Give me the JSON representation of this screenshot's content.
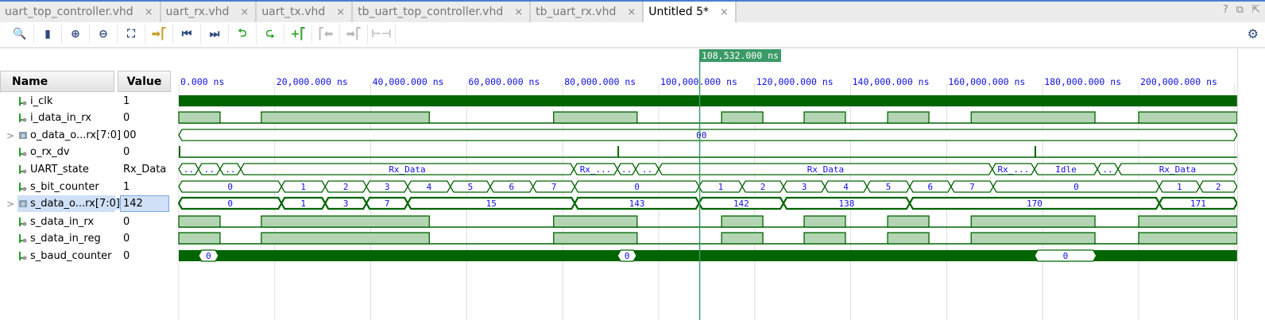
{
  "tabs": [
    {
      "label": "uart_top_controller.vhd",
      "active": false
    },
    {
      "label": "uart_rx.vhd",
      "active": false
    },
    {
      "label": "uart_tx.vhd",
      "active": false
    },
    {
      "label": "tb_uart_top_controller.vhd",
      "active": false
    },
    {
      "label": "tb_uart_rx.vhd",
      "active": false
    },
    {
      "label": "Untitled 5*",
      "active": true
    }
  ],
  "tab_close": "×",
  "window_controls": {
    "help": "?",
    "restore": "⧉",
    "float": "⇱"
  },
  "toolbar": [
    {
      "icon": "search-icon",
      "glyph": "🔍",
      "color": "#2d4a80"
    },
    {
      "icon": "save-icon",
      "glyph": "▮",
      "color": "#2d4a80"
    },
    {
      "icon": "zoom-in-icon",
      "glyph": "⊕",
      "color": "#2d4a80"
    },
    {
      "icon": "zoom-out-icon",
      "glyph": "⊖",
      "color": "#2d4a80"
    },
    {
      "icon": "zoom-fit-icon",
      "glyph": "⛶",
      "color": "#2d4a80"
    },
    {
      "icon": "go-to-cursor-icon",
      "glyph": "➡⎡",
      "color": "#c8a030"
    },
    {
      "icon": "go-to-start-icon",
      "glyph": "⏮",
      "color": "#2d4a80"
    },
    {
      "icon": "go-to-end-icon",
      "glyph": "⏭",
      "color": "#2d4a80"
    },
    {
      "icon": "previous-transition-icon",
      "glyph": "⮌",
      "color": "#2aa02a"
    },
    {
      "icon": "next-transition-icon",
      "glyph": "⮎",
      "color": "#2aa02a"
    },
    {
      "icon": "add-marker-icon",
      "glyph": "+⎡",
      "color": "#2aa02a"
    },
    {
      "icon": "previous-marker-icon",
      "glyph": "⎡⬅",
      "color": "#bbb"
    },
    {
      "icon": "next-marker-icon",
      "glyph": "➡⎡",
      "color": "#bbb"
    },
    {
      "icon": "swap-cursors-icon",
      "glyph": "⊢⊣",
      "color": "#bbb"
    }
  ],
  "headers": {
    "name": "Name",
    "value": "Value"
  },
  "cursor": {
    "label": "108,532.000 ns",
    "time": 108.532
  },
  "time_unit": "M ns",
  "ticks": [
    "0.000 ns",
    "20,000.000 ns",
    "40,000.000 ns",
    "60,000.000 ns",
    "80,000.000 ns",
    "100,000.000 ns",
    "120,000.000 ns",
    "140,000.000 ns",
    "160,000.000 ns",
    "180,000.000 ns",
    "200,000.000 ns"
  ],
  "end_time": 220.5,
  "colors": {
    "wave": "#006400",
    "high_fill": "#b3d5b3",
    "text": "#1010e0",
    "cursor": "#3b9a67"
  },
  "signals": [
    {
      "name": "i_clk",
      "value": "1",
      "kind": "clock"
    },
    {
      "name": "i_data_in_rx",
      "value": "0",
      "kind": "bit",
      "high": [
        [
          0,
          8.6
        ],
        [
          17.2,
          52.2
        ],
        [
          78.1,
          95.5
        ],
        [
          113.1,
          121.7
        ],
        [
          130.3,
          138.9
        ],
        [
          147.7,
          156.3
        ],
        [
          165.1,
          190.9
        ],
        [
          200,
          220.5
        ]
      ]
    },
    {
      "name": "o_data_o...rx[7:0]",
      "value": "00",
      "kind": "bus",
      "expandable": true,
      "segments": [
        [
          0,
          220.5,
          "00"
        ]
      ],
      "label_at": 108.9
    },
    {
      "name": "o_rx_dv",
      "value": "0",
      "kind": "pulse",
      "pulses": [
        0,
        91.4,
        178.3
      ]
    },
    {
      "name": "UART_state",
      "value": "Rx_Data",
      "kind": "bus",
      "segments": [
        [
          0,
          4.1,
          ".."
        ],
        [
          4.1,
          8.6,
          ".."
        ],
        [
          8.6,
          12.9,
          ".."
        ],
        [
          12.9,
          82.3,
          "Rx_Data"
        ],
        [
          82.3,
          91.4,
          "Rx_..."
        ],
        [
          91.4,
          95.2,
          ".."
        ],
        [
          95.2,
          100,
          ".."
        ],
        [
          100,
          169.5,
          "Rx_Data"
        ],
        [
          169.5,
          178.3,
          "Rx_..."
        ],
        [
          178.3,
          191.4,
          "Idle"
        ],
        [
          191.4,
          195.7,
          ".."
        ],
        [
          195.7,
          220.5,
          "Rx_Data"
        ]
      ]
    },
    {
      "name": "s_bit_counter",
      "value": "1",
      "kind": "bus",
      "segments": [
        [
          0,
          21.4,
          "0"
        ],
        [
          21.4,
          30.5,
          "1"
        ],
        [
          30.5,
          39.1,
          "2"
        ],
        [
          39.1,
          47.7,
          "3"
        ],
        [
          47.7,
          56.6,
          "4"
        ],
        [
          56.6,
          64.9,
          "5"
        ],
        [
          64.9,
          73.8,
          "6"
        ],
        [
          73.8,
          82.5,
          "7"
        ],
        [
          82.5,
          108.4,
          "0"
        ],
        [
          108.4,
          117.4,
          "1"
        ],
        [
          117.4,
          126,
          "2"
        ],
        [
          126,
          134.6,
          "3"
        ],
        [
          134.6,
          143.4,
          "4"
        ],
        [
          143.4,
          152.3,
          "5"
        ],
        [
          152.3,
          160.9,
          "6"
        ],
        [
          160.9,
          169.7,
          "7"
        ],
        [
          169.7,
          204.3,
          "0"
        ],
        [
          204.3,
          212.7,
          "1"
        ],
        [
          212.7,
          220.5,
          "2"
        ]
      ]
    },
    {
      "name": "s_data_o...rx[7:0]",
      "value": "142",
      "kind": "bus",
      "selected": true,
      "expandable": true,
      "segments": [
        [
          0,
          21.4,
          "0"
        ],
        [
          21.4,
          30.5,
          "1"
        ],
        [
          30.5,
          39.1,
          "3"
        ],
        [
          39.1,
          47.7,
          "7"
        ],
        [
          47.7,
          82.5,
          "15"
        ],
        [
          82.5,
          108.4,
          "143"
        ],
        [
          108.4,
          126,
          "142"
        ],
        [
          126,
          152.3,
          "138"
        ],
        [
          152.3,
          204.3,
          "170"
        ],
        [
          204.3,
          220.5,
          "171"
        ]
      ]
    },
    {
      "name": "s_data_in_rx",
      "value": "0",
      "kind": "bit",
      "high": [
        [
          0,
          8.6
        ],
        [
          17.2,
          52.2
        ],
        [
          78.1,
          95.5
        ],
        [
          113.1,
          121.7
        ],
        [
          130.3,
          138.9
        ],
        [
          147.7,
          156.3
        ],
        [
          165.1,
          190.9
        ],
        [
          200,
          220.5
        ]
      ]
    },
    {
      "name": "s_data_in_reg",
      "value": "0",
      "kind": "bit",
      "high": [
        [
          0,
          8.6
        ],
        [
          17.2,
          52.2
        ],
        [
          78.1,
          95.5
        ],
        [
          113.1,
          121.7
        ],
        [
          130.3,
          138.9
        ],
        [
          147.7,
          156.3
        ],
        [
          165.1,
          190.9
        ],
        [
          200,
          220.5
        ]
      ]
    },
    {
      "name": "s_baud_counter",
      "value": "0",
      "kind": "dense",
      "gaps": [
        [
          4.1,
          8.3,
          "0"
        ],
        [
          91.4,
          95.4,
          "0"
        ],
        [
          178.3,
          191.2,
          "0"
        ]
      ]
    }
  ]
}
